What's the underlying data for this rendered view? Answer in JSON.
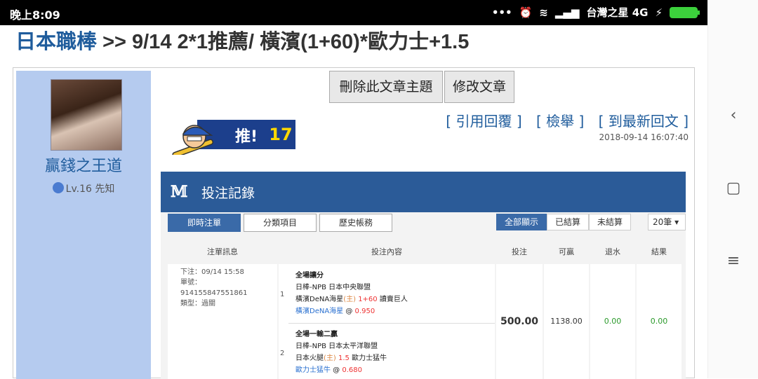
{
  "status": {
    "time": "晚上8:09",
    "carrier": "台灣之星 4G"
  },
  "page": {
    "category": "日本職棒",
    "title": " >> 9/14 2*1推薦/ 橫濱(1+60)*歐力士+1.5"
  },
  "author": {
    "name": "贏錢之王道",
    "level": "Lv.16 先知"
  },
  "actions": {
    "delete_label": "刪除此文章主題",
    "edit_label": "修改文章",
    "quote_label": "[ 引用回覆 ]",
    "report_label": "[ 檢舉 ]",
    "latest_label": "[ 到最新回文 ]",
    "timestamp": "2018-09-14 16:07:40"
  },
  "push": {
    "label": "推!",
    "count": "17"
  },
  "bet_panel": {
    "title": "投注記錄",
    "tabs": [
      "即時注單",
      "分類項目",
      "歷史帳務"
    ],
    "filters": [
      "全部顯示",
      "已結算",
      "未結算"
    ],
    "per_page": "20筆",
    "headers": [
      "注單訊息",
      "投注內容",
      "投注",
      "可贏",
      "退水",
      "結果"
    ],
    "order": {
      "date_label": "下注：",
      "date": "09/14 15:58",
      "id_label": "單號：",
      "id": "914155847551861",
      "type_label": "類型：",
      "type": "過關"
    },
    "bets": [
      {
        "num": "1",
        "market": "全場讓分",
        "league": "日棒-NPB 日本中央聯盟",
        "team_home": "橫濱DeNA海星",
        "home_tag": "(主)",
        "line": "1+60",
        "team_away": "讀賣巨人",
        "pick": "橫濱DeNA海星",
        "odds": "0.950"
      },
      {
        "num": "2",
        "market": "全場一輸二贏",
        "league": "日棒-NPB 日本太平洋聯盟",
        "team_home": "日本火腿",
        "home_tag": "(主)",
        "line": "1.5",
        "team_away": "歐力士猛牛",
        "pick": "歐力士猛牛",
        "odds": "0.680"
      }
    ],
    "stake": "500.00",
    "win": "1138.00",
    "rebate": "0.00",
    "result": "0.00"
  },
  "colors": {
    "title_blue": "#1f5c9c",
    "sidebar": "#b5cbef",
    "panel_header": "#2b5b98",
    "green": "#2b9a2b",
    "red": "#e33333"
  }
}
